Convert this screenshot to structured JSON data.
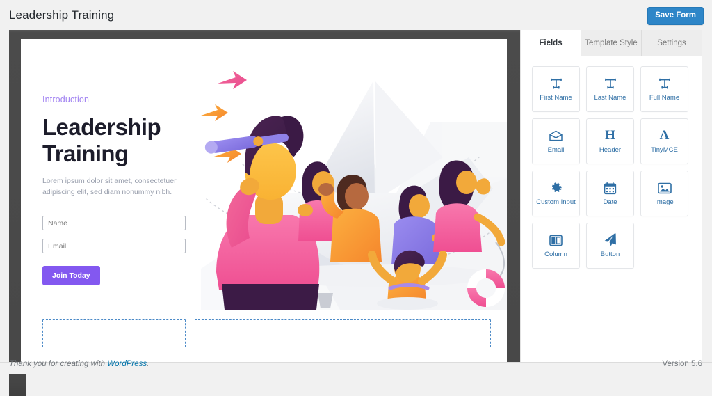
{
  "topbar": {
    "page_title": "Leadership Training",
    "save_label": "Save Form",
    "accent_color": "#2e86c8"
  },
  "preview": {
    "eyebrow": "Introduction",
    "heading": "Leadership\nTraining",
    "subtext": "Lorem ipsum dolor sit amet, consectetuer adipiscing elit, sed diam nonummy nibh.",
    "eyebrow_color": "#a385f2",
    "button_color": "#8358f0",
    "fields": [
      {
        "name": "name",
        "placeholder": "Name"
      },
      {
        "name": "email",
        "placeholder": "Email"
      }
    ],
    "submit_label": "Join Today",
    "illustration": "team-in-paper-boat-with-leader-holding-telescope",
    "dropzones": [
      {
        "name": "dropzone-left",
        "label": ""
      },
      {
        "name": "dropzone-right",
        "label": ""
      }
    ]
  },
  "sidebar": {
    "tabs": [
      {
        "label": "Fields",
        "active": true
      },
      {
        "label": "Template Style",
        "active": false
      },
      {
        "label": "Settings",
        "active": false
      }
    ],
    "fields": [
      {
        "label": "First Name",
        "icon": "text-field-icon"
      },
      {
        "label": "Last Name",
        "icon": "text-field-icon"
      },
      {
        "label": "Full Name",
        "icon": "text-field-icon"
      },
      {
        "label": "Email",
        "icon": "envelope-icon"
      },
      {
        "label": "Header",
        "icon": "heading-h-icon"
      },
      {
        "label": "TinyMCE",
        "icon": "letter-a-icon"
      },
      {
        "label": "Custom Input",
        "icon": "gear-icon"
      },
      {
        "label": "Date",
        "icon": "calendar-icon"
      },
      {
        "label": "Image",
        "icon": "image-icon"
      },
      {
        "label": "Column",
        "icon": "columns-icon"
      },
      {
        "label": "Button",
        "icon": "paper-plane-icon"
      }
    ],
    "icon_color": "#2f6fa5"
  },
  "footer": {
    "credit_prefix": "Thank you for creating with ",
    "credit_link": "WordPress",
    "credit_suffix": ".",
    "version": "Version 5.6"
  }
}
